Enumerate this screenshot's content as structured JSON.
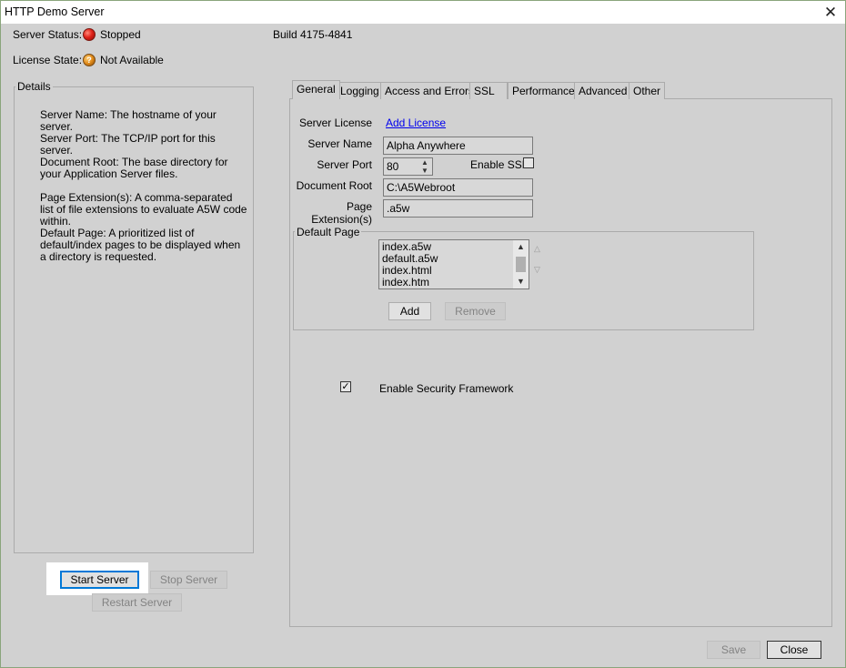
{
  "window": {
    "title": "HTTP Demo Server",
    "close_glyph": "✕"
  },
  "status": {
    "server_label": "Server Status:",
    "server_value": "Stopped",
    "license_label": "License State:",
    "license_value": "Not Available",
    "license_icon_glyph": "?",
    "build": "Build 4175-4841"
  },
  "details": {
    "legend": "Details",
    "items": [
      "Server Name: The hostname of your server.",
      "Server Port: The TCP/IP port for this server.",
      "Document Root: The base directory for your Application Server files.",
      "Page Extension(s): A comma-separated list of file extensions to evaluate A5W code within.",
      "Default Page: A prioritized list of default/index pages to be displayed when a directory is requested."
    ]
  },
  "buttons": {
    "start": "Start Server",
    "stop": "Stop Server",
    "restart": "Restart Server",
    "add": "Add",
    "remove": "Remove",
    "save": "Save",
    "close": "Close"
  },
  "tabs": [
    "General",
    "Logging",
    "Access and Errors",
    "SSL",
    "Performance",
    "Advanced",
    "Other"
  ],
  "general": {
    "license_label": "Server License",
    "license_link": "Add License",
    "name_label": "Server Name",
    "name_value": "Alpha Anywhere",
    "port_label": "Server Port",
    "port_value": "80",
    "ssl_label": "Enable SSL",
    "ssl_checked": false,
    "docroot_label": "Document Root",
    "docroot_value": "C:\\A5Webroot",
    "ext_label": "Page Extension(s)",
    "ext_value": ".a5w",
    "default_page_legend": "Default Page",
    "default_pages": [
      "index.a5w",
      "default.a5w",
      "index.html",
      "index.htm"
    ],
    "security_label": "Enable Security Framework",
    "security_check_glyph": "✓"
  },
  "colors": {
    "background": "#d1d1d1",
    "accent": "#0078d7",
    "link": "#0000ee",
    "status_stopped": "#e0231a",
    "status_license": "#e08a1a"
  }
}
